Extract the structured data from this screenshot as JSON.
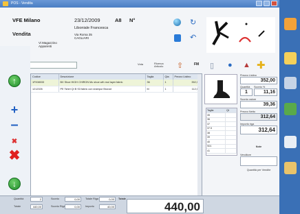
{
  "window": {
    "title": "POS - Vendita"
  },
  "header": {
    "store": "VFE Milano",
    "date": "23/12/2009",
    "code": "A8",
    "number_label": "N°",
    "mode": "Vendita",
    "customer": "Liboniale Francesca",
    "customer_sub": "Via Roma 35",
    "customer_city": "CAGLIARI",
    "warehouse_line1": "Vi Magazzino",
    "warehouse_line2": "Apparenti"
  },
  "toolbar": {
    "fm_label": "FM",
    "lbl1": "Vota",
    "lbl2": "Ricerca Articolo"
  },
  "table": {
    "columns": [
      "Codice",
      "Descrizione",
      "Taglia",
      "Qta",
      "Prezzo Listino"
    ],
    "rows": [
      [
        "1F008033",
        "BX Shoe HIGH CHIRON Mo shoe wth mul layer fabric",
        "36",
        "1",
        "352,00"
      ],
      [
        "1212026",
        "PE Tshirt QI B S3 fabric con shahpur Bronze",
        "M",
        "1",
        "112,00"
      ]
    ]
  },
  "sizes": {
    "header": [
      "Taglia",
      "Qt"
    ],
    "rows": [
      [
        "35",
        ""
      ],
      [
        "36",
        ""
      ],
      [
        "37",
        ""
      ],
      [
        "37.5",
        ""
      ],
      [
        "38",
        ""
      ],
      [
        "39",
        ""
      ],
      [
        "40",
        ""
      ],
      [
        "S01",
        ""
      ],
      [
        "41",
        ""
      ]
    ]
  },
  "prices": {
    "list_price_label": "Prezzo Listino",
    "list_price": "352,00",
    "qty_label": "Quantità",
    "qty": "1",
    "discount_label": "Sconto %",
    "discount": "11,16",
    "discount_val_label": "Sconto valore",
    "discount_val": "39,36",
    "net_label": "Prezzo Netto",
    "net": "312,64",
    "row_total_label": "Importo riga",
    "row_total": "312,64",
    "notes_label": "Note",
    "seller_label": "Venditore",
    "qty_seller_label": "Quantità per Vendite"
  },
  "bottom": {
    "qty_label": "Quantità",
    "qty": "2",
    "tot_label": "Totale",
    "tot": "440,00",
    "disc_label": "Sconto",
    "disc": "0,00",
    "cost_label": "Sconto Riga",
    "cost": "0,00",
    "t2_label": "Totale Riga",
    "t2": "0,00",
    "t3_label": "Importo",
    "t3": "40,00",
    "total_label": "Totale",
    "total": "440,00"
  },
  "colors": {
    "accent": "#3a70b6",
    "green": "#1f8c2a",
    "red": "#e02020"
  }
}
